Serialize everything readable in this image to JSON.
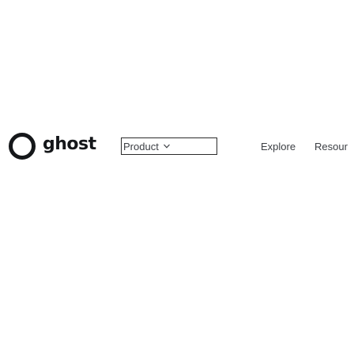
{
  "brand": {
    "name": "ghost",
    "logo_icon": "ghost-logo-ring-icon"
  },
  "nav": {
    "product_label": "Product",
    "product_chevron_icon": "chevron-down-icon",
    "explore_label": "Explore",
    "resources_label": "Resour"
  },
  "colors": {
    "background": "#ffffff",
    "text": "#15171a",
    "nav_text": "#3c3f44",
    "focus_border": "#2b2b2b"
  }
}
